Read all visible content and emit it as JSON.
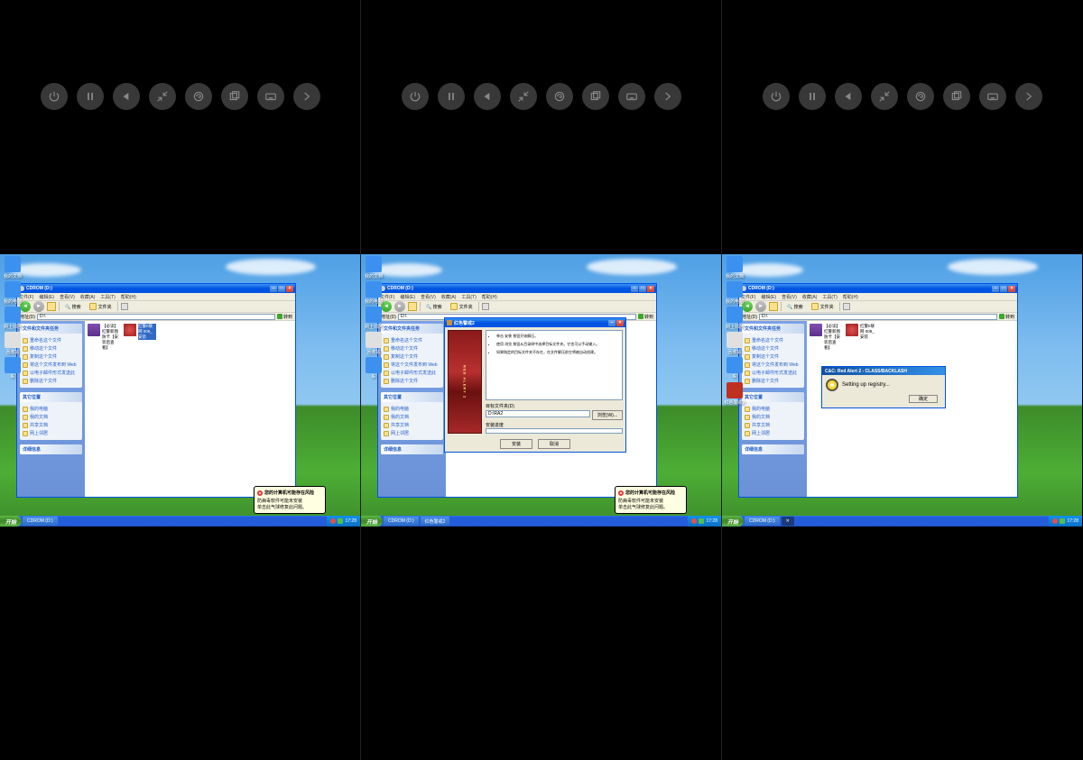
{
  "toolbar_icons": [
    "power",
    "pause",
    "back",
    "shrink",
    "swirl",
    "windowed",
    "keyboard",
    "forward"
  ],
  "explorer": {
    "title": "CDROM (D:)",
    "menu": [
      "文件(F)",
      "编辑(E)",
      "查看(V)",
      "收藏(A)",
      "工具(T)",
      "帮助(H)"
    ],
    "nav": {
      "search": "搜索",
      "folders": "文件夹"
    },
    "addr_label": "地址(D)",
    "addr_value": "D:\\",
    "go": "转到",
    "sidebar": {
      "tasks_header": "文件和文件夹任务",
      "tasks": [
        "重命名这个文件",
        "移动这个文件",
        "复制这个文件",
        "将这个文件发布到 Web",
        "以电子邮件形式发送此",
        "删除这个文件"
      ],
      "other_header": "其它位置",
      "other": [
        "我的电脑",
        "我的文档",
        "共享文档",
        "网上邻居"
      ],
      "details_header": "详细信息"
    },
    "files": [
      {
        "name": "【必读】红警新图防卡【安装后查看】",
        "type": "rar"
      },
      {
        "name": "红警II联网 008_安装",
        "type": "exe"
      }
    ],
    "file_sel": "红警II联网 008_安装"
  },
  "balloon": {
    "title": "您的计算机可能存在风险",
    "line1": "防病毒软件可能未安装",
    "line2": "单击此气球修复此问题。"
  },
  "taskbar": {
    "start": "开始",
    "tasks_p1": [
      "CDROM (D:)"
    ],
    "tasks_p2": [
      "CDROM (D:)",
      "红色警戒2"
    ],
    "tasks_p3": [
      "CDROM (D:)"
    ],
    "time": "17:28"
  },
  "rar_dialog": {
    "title": "红色警戒2",
    "side_text": "RED ALERT 2",
    "bullets": [
      "单击 安装 按钮开始解压。",
      "使用 浏览 按钮从目录树中选择目标文件夹。它也可以手动输入。",
      "如果指定的目标文件夹不存在，在文件解压前它将被自动创建。"
    ],
    "dest_label": "目标文件夹(D)",
    "dest_value": "D:\\RA2",
    "progress_label": "安装进度",
    "browse": "浏览(W)...",
    "install": "安装",
    "cancel": "取消"
  },
  "install_dialog": {
    "title": "C&C: Red Alert 2 - CLASS/BACKLASH",
    "text": "Setting up registry...",
    "ok": "确定"
  },
  "desktop_icons": [
    {
      "label": "我的文档",
      "color": "#3C91F0"
    },
    {
      "label": "我的电脑",
      "color": "#3C91F0"
    },
    {
      "label": "网上邻居",
      "color": "#3C91F0"
    },
    {
      "label": "回收站",
      "color": "#E0E0E0"
    },
    {
      "label": "IE",
      "color": "#3C91F0"
    }
  ],
  "extra_icons_p3": [
    {
      "label": "红色警戒2",
      "color": "#C03020"
    }
  ]
}
